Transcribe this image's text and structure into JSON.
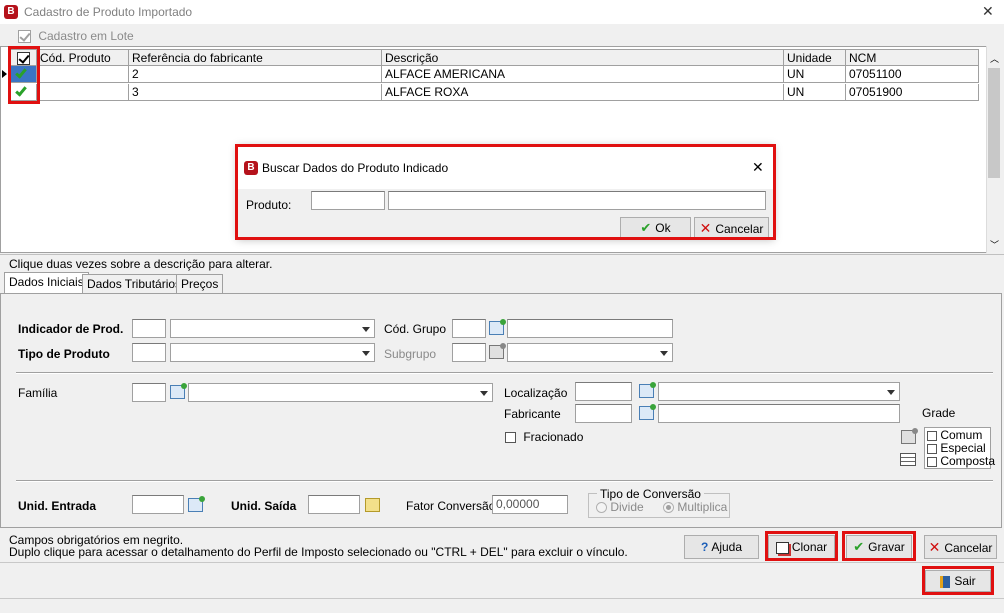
{
  "window": {
    "title": "Cadastro de Produto Importado",
    "logo": "B"
  },
  "batch": {
    "label": "Cadastro em Lote",
    "checked": true
  },
  "grid": {
    "columns": [
      "Cód. Produto",
      "Referência do fabricante",
      "Descrição",
      "Unidade",
      "NCM"
    ],
    "rows": [
      {
        "cod": "",
        "ref": "2",
        "desc": "ALFACE AMERICANA",
        "un": "UN",
        "ncm": "07051100"
      },
      {
        "cod": "",
        "ref": "3",
        "desc": "ALFACE ROXA",
        "un": "UN",
        "ncm": "07051900"
      }
    ]
  },
  "dialog": {
    "title": "Buscar Dados do Produto Indicado",
    "logo": "B",
    "produto_label": "Produto:",
    "ok_label": "Ok",
    "cancel_label": "Cancelar"
  },
  "hint": "Clique duas vezes sobre a descrição para alterar.",
  "tabs": [
    "Dados Iniciais",
    "Dados Tributários",
    "Preços"
  ],
  "form": {
    "indicador_label": "Indicador de Prod.",
    "tipo_label": "Tipo de Produto",
    "cod_grupo_label": "Cód. Grupo",
    "subgrupo_label": "Subgrupo",
    "familia_label": "Família",
    "localizacao_label": "Localização",
    "fabricante_label": "Fabricante",
    "fracionado_label": "Fracionado",
    "grade_label": "Grade",
    "grade_options": [
      "Comum",
      "Especial",
      "Composta"
    ],
    "unid_entrada_label": "Unid. Entrada",
    "unid_saida_label": "Unid. Saída",
    "fator_label": "Fator Conversão",
    "fator_value": "0,00000",
    "tipo_conv_label": "Tipo de Conversão",
    "divide_label": "Divide",
    "multiplica_label": "Multiplica"
  },
  "footer": {
    "note1": "Campos obrigatórios em negrito.",
    "note2": "Duplo clique para acessar o detalhamento do Perfil de Imposto selecionado ou \"CTRL + DEL\" para excluir o vínculo.",
    "ajuda": "Ajuda",
    "clonar": "Clonar",
    "gravar": "Gravar",
    "cancelar": "Cancelar",
    "sair": "Sair"
  },
  "colors": {
    "highlight": "#e01010",
    "check_green": "#2aa12a",
    "logo_red": "#b5121b"
  }
}
